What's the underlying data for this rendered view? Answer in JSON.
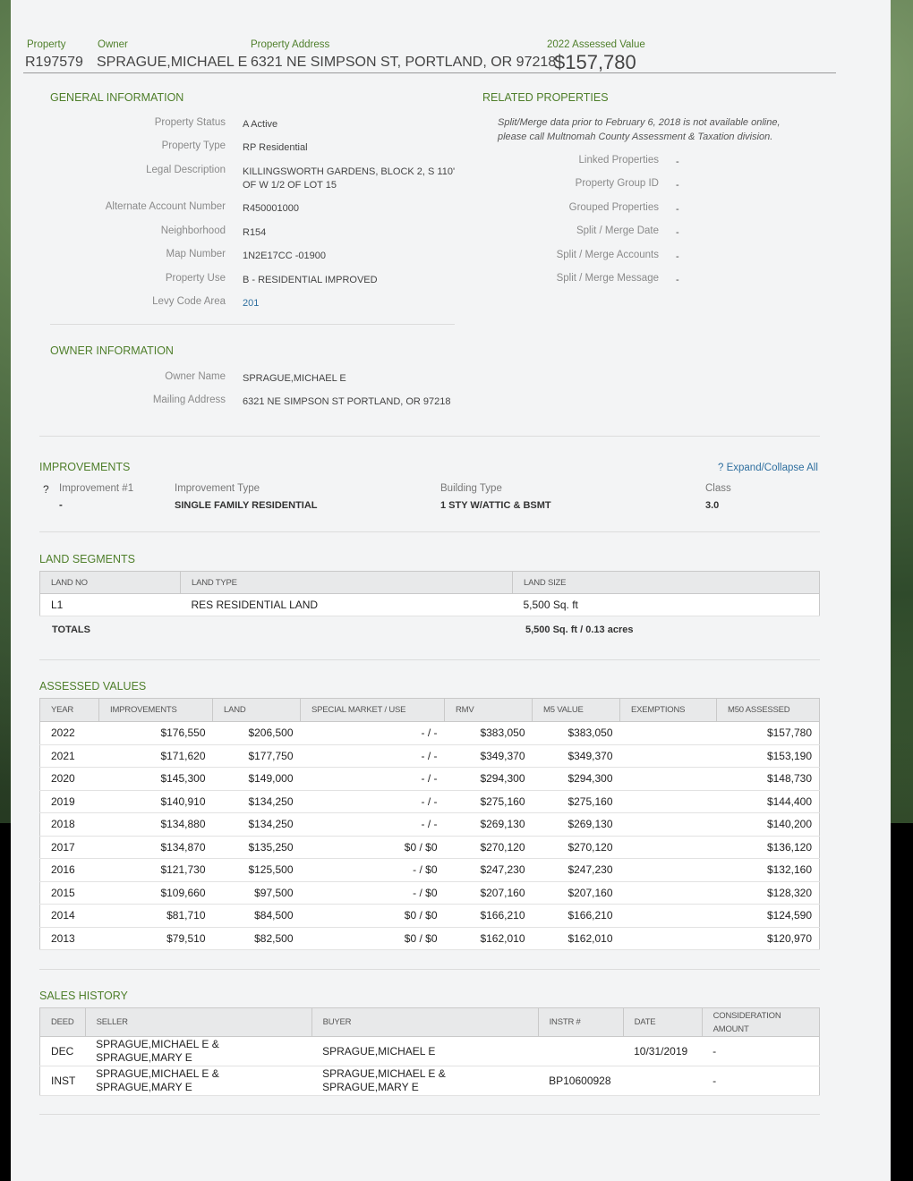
{
  "header": {
    "property_label": "Property",
    "property_value": "R197579",
    "owner_label": "Owner",
    "owner_value": "SPRAGUE,MICHAEL E",
    "address_label": "Property Address",
    "address_value": "6321 NE SIMPSON ST, PORTLAND, OR 97218",
    "assessed_label": "2022 Assessed Value",
    "assessed_value": "$157,780"
  },
  "general": {
    "title": "GENERAL INFORMATION",
    "rows": [
      {
        "label": "Property Status",
        "value": "A Active"
      },
      {
        "label": "Property Type",
        "value": "RP Residential"
      },
      {
        "label": "Legal Description",
        "value": "KILLINGSWORTH GARDENS, BLOCK 2, S 110' OF W 1/2 OF LOT 15"
      },
      {
        "label": "Alternate Account Number",
        "value": "R450001000"
      },
      {
        "label": "Neighborhood",
        "value": "R154"
      },
      {
        "label": "Map Number",
        "value": "1N2E17CC -01900"
      },
      {
        "label": "Property Use",
        "value": "B - RESIDENTIAL IMPROVED"
      },
      {
        "label": "Levy Code Area",
        "value": "201"
      }
    ]
  },
  "related": {
    "title": "RELATED PROPERTIES",
    "note": "Split/Merge data prior to February 6, 2018 is not available online, please call Multnomah County Assessment & Taxation division.",
    "rows": [
      {
        "label": "Linked Properties",
        "value": "-"
      },
      {
        "label": "Property Group ID",
        "value": "-"
      },
      {
        "label": "Grouped Properties",
        "value": "-"
      },
      {
        "label": "Split / Merge Date",
        "value": "-"
      },
      {
        "label": "Split / Merge Accounts",
        "value": "-"
      },
      {
        "label": "Split / Merge Message",
        "value": "-"
      }
    ]
  },
  "owner_info": {
    "title": "OWNER INFORMATION",
    "rows": [
      {
        "label": "Owner Name",
        "value": "SPRAGUE,MICHAEL E"
      },
      {
        "label": "Mailing Address",
        "value": "6321 NE SIMPSON ST PORTLAND, OR 97218"
      }
    ]
  },
  "improvements": {
    "title": "IMPROVEMENTS",
    "expand_label": "? Expand/Collapse All",
    "toggle": "?",
    "num_label": "Improvement #1",
    "num_value": "-",
    "type_label": "Improvement Type",
    "type_value": "SINGLE FAMILY RESIDENTIAL",
    "building_label": "Building Type",
    "building_value": "1 STY W/ATTIC & BSMT",
    "class_label": "Class",
    "class_value": "3.0"
  },
  "land": {
    "title": "LAND SEGMENTS",
    "headers": [
      "LAND NO",
      "LAND TYPE",
      "LAND SIZE"
    ],
    "row": [
      "L1",
      "RES RESIDENTIAL LAND",
      "5,500 Sq. ft"
    ],
    "totals_label": "TOTALS",
    "totals_value": "5,500 Sq. ft / 0.13 acres"
  },
  "assessed": {
    "title": "ASSESSED VALUES",
    "headers": [
      "YEAR",
      "IMPROVEMENTS",
      "LAND",
      "SPECIAL MARKET / USE",
      "RMV",
      "M5 VALUE",
      "EXEMPTIONS",
      "M50 ASSESSED"
    ],
    "rows": [
      [
        "2022",
        "$176,550",
        "$206,500",
        "- / -",
        "$383,050",
        "$383,050",
        "",
        "$157,780"
      ],
      [
        "2021",
        "$171,620",
        "$177,750",
        "- / -",
        "$349,370",
        "$349,370",
        "",
        "$153,190"
      ],
      [
        "2020",
        "$145,300",
        "$149,000",
        "- / -",
        "$294,300",
        "$294,300",
        "",
        "$148,730"
      ],
      [
        "2019",
        "$140,910",
        "$134,250",
        "- / -",
        "$275,160",
        "$275,160",
        "",
        "$144,400"
      ],
      [
        "2018",
        "$134,880",
        "$134,250",
        "- / -",
        "$269,130",
        "$269,130",
        "",
        "$140,200"
      ],
      [
        "2017",
        "$134,870",
        "$135,250",
        "$0 / $0",
        "$270,120",
        "$270,120",
        "",
        "$136,120"
      ],
      [
        "2016",
        "$121,730",
        "$125,500",
        "- / $0",
        "$247,230",
        "$247,230",
        "",
        "$132,160"
      ],
      [
        "2015",
        "$109,660",
        "$97,500",
        "- / $0",
        "$207,160",
        "$207,160",
        "",
        "$128,320"
      ],
      [
        "2014",
        "$81,710",
        "$84,500",
        "$0 / $0",
        "$166,210",
        "$166,210",
        "",
        "$124,590"
      ],
      [
        "2013",
        "$79,510",
        "$82,500",
        "$0 / $0",
        "$162,010",
        "$162,010",
        "",
        "$120,970"
      ]
    ]
  },
  "sales": {
    "title": "SALES HISTORY",
    "headers": [
      "DEED",
      "SELLER",
      "BUYER",
      "INSTR #",
      "DATE",
      "CONSIDERATION AMOUNT"
    ],
    "rows": [
      [
        "DEC",
        "SPRAGUE,MICHAEL E & SPRAGUE,MARY E",
        "SPRAGUE,MICHAEL E",
        "",
        "10/31/2019",
        "-"
      ],
      [
        "INST",
        "SPRAGUE,MICHAEL E & SPRAGUE,MARY E",
        "SPRAGUE,MICHAEL E & SPRAGUE,MARY E",
        "BP10600928",
        "",
        "-"
      ]
    ]
  }
}
